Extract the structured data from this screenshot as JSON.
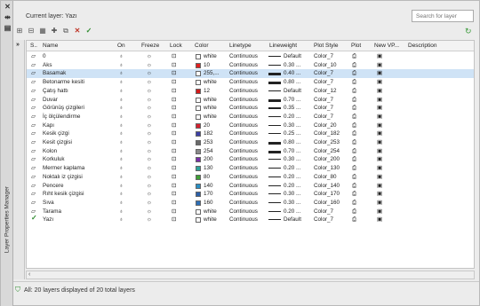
{
  "palette": {
    "vertical_title": "Layer Properties Manager",
    "current_layer_label": "Current layer: Yazı",
    "search_placeholder": "Search for layer",
    "status_text": "All: 20 layers displayed of 20 total layers"
  },
  "columns": [
    "S..",
    "Name",
    "On",
    "Freeze",
    "Lock",
    "Color",
    "Linetype",
    "Lineweight",
    "Plot Style",
    "Plot",
    "New VP...",
    "Description"
  ],
  "layers": [
    {
      "name": "0",
      "color": "white",
      "hex": "#ffffff",
      "linetype": "Continuous",
      "lineweight": "Default",
      "lw": "thin",
      "plot_style": "Color_7",
      "current": false,
      "selected": false
    },
    {
      "name": "Aks",
      "color": "10",
      "hex": "#e02020",
      "linetype": "Continuous",
      "lineweight": "0.30 ...",
      "lw": "thin",
      "plot_style": "Color_10",
      "current": false,
      "selected": false
    },
    {
      "name": "Basamak",
      "color": "255,...",
      "hex": "#ffffff",
      "linetype": "Continuous",
      "lineweight": "0.40 ...",
      "lw": "thick",
      "plot_style": "Color_7",
      "current": false,
      "selected": true
    },
    {
      "name": "Betonarme kesiti",
      "color": "white",
      "hex": "#ffffff",
      "linetype": "Continuous",
      "lineweight": "0.80 ...",
      "lw": "thick",
      "plot_style": "Color_7",
      "current": false,
      "selected": false
    },
    {
      "name": "Çatış hattı",
      "color": "12",
      "hex": "#d21a1a",
      "linetype": "Continuous",
      "lineweight": "Default",
      "lw": "thin",
      "plot_style": "Color_12",
      "current": false,
      "selected": false
    },
    {
      "name": "Duvar",
      "color": "white",
      "hex": "#ffffff",
      "linetype": "Continuous",
      "lineweight": "0.70 ...",
      "lw": "thick",
      "plot_style": "Color_7",
      "current": false,
      "selected": false
    },
    {
      "name": "Görünüş çizgileri",
      "color": "white",
      "hex": "#ffffff",
      "linetype": "Continuous",
      "lineweight": "0.35 ...",
      "lw": "med",
      "plot_style": "Color_7",
      "current": false,
      "selected": false
    },
    {
      "name": "İç ölçülendirme",
      "color": "white",
      "hex": "#ffffff",
      "linetype": "Continuous",
      "lineweight": "0.20 ...",
      "lw": "thin",
      "plot_style": "Color_7",
      "current": false,
      "selected": false
    },
    {
      "name": "Kapı",
      "color": "20",
      "hex": "#d4202f",
      "linetype": "Continuous",
      "lineweight": "0.30 ...",
      "lw": "thin",
      "plot_style": "Color_20",
      "current": false,
      "selected": false
    },
    {
      "name": "Kesik çizgi",
      "color": "182",
      "hex": "#3c3fa6",
      "linetype": "Continuous",
      "lineweight": "0.25 ...",
      "lw": "thin",
      "plot_style": "Color_182",
      "current": false,
      "selected": false
    },
    {
      "name": "Kesit çizgisi",
      "color": "253",
      "hex": "#6a6a6a",
      "linetype": "Continuous",
      "lineweight": "0.80 ...",
      "lw": "thick",
      "plot_style": "Color_253",
      "current": false,
      "selected": false
    },
    {
      "name": "Kolon",
      "color": "254",
      "hex": "#8a8a8a",
      "linetype": "Continuous",
      "lineweight": "0.70 ...",
      "lw": "thick",
      "plot_style": "Color_254",
      "current": false,
      "selected": false
    },
    {
      "name": "Korkuluk",
      "color": "200",
      "hex": "#7a2fa8",
      "linetype": "Continuous",
      "lineweight": "0.30 ...",
      "lw": "thin",
      "plot_style": "Color_200",
      "current": false,
      "selected": false
    },
    {
      "name": "Mermer kaplama",
      "color": "130",
      "hex": "#2ea39c",
      "linetype": "Continuous",
      "lineweight": "0.20 ...",
      "lw": "thin",
      "plot_style": "Color_130",
      "current": false,
      "selected": false
    },
    {
      "name": "Noktalı iz çizgisi",
      "color": "80",
      "hex": "#3fa035",
      "linetype": "Continuous",
      "lineweight": "0.20 ...",
      "lw": "thin",
      "plot_style": "Color_80",
      "current": false,
      "selected": false
    },
    {
      "name": "Pencere",
      "color": "140",
      "hex": "#2a8fc4",
      "linetype": "Continuous",
      "lineweight": "0.20 ...",
      "lw": "thin",
      "plot_style": "Color_140",
      "current": false,
      "selected": false
    },
    {
      "name": "Rıht kesik çizgisi",
      "color": "170",
      "hex": "#2b5fa8",
      "linetype": "Continuous",
      "lineweight": "0.30 ...",
      "lw": "thin",
      "plot_style": "Color_170",
      "current": false,
      "selected": false
    },
    {
      "name": "Sıva",
      "color": "160",
      "hex": "#2d6fb6",
      "linetype": "Continuous",
      "lineweight": "0.30 ...",
      "lw": "thin",
      "plot_style": "Color_160",
      "current": false,
      "selected": false
    },
    {
      "name": "Tarama",
      "color": "white",
      "hex": "#ffffff",
      "linetype": "Continuous",
      "lineweight": "0.20 ...",
      "lw": "thin",
      "plot_style": "Color_7",
      "current": false,
      "selected": false
    },
    {
      "name": "Yazı",
      "color": "white",
      "hex": "#ffffff",
      "linetype": "Continuous",
      "lineweight": "Default",
      "lw": "thin",
      "plot_style": "Color_7",
      "current": true,
      "selected": false
    }
  ]
}
